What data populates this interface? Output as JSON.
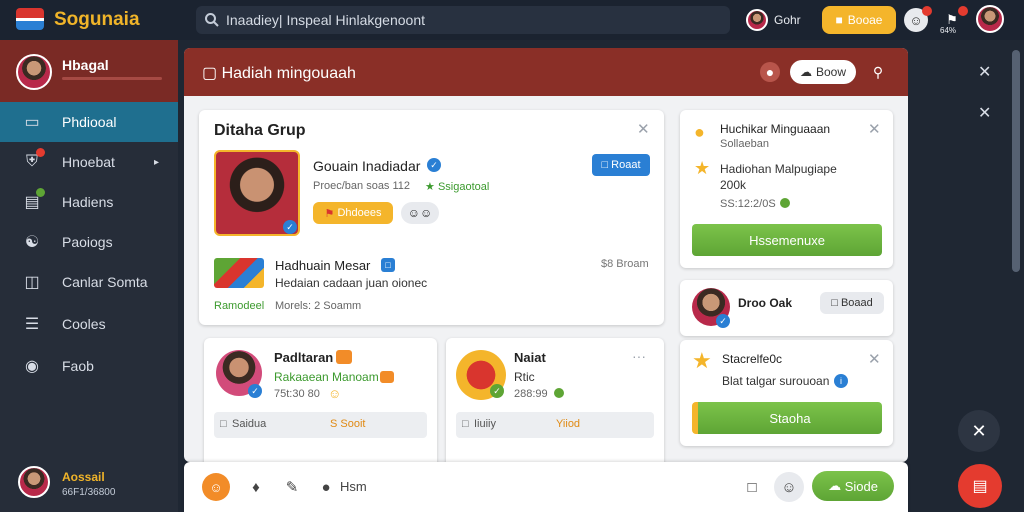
{
  "app": {
    "brand": "Sogunaia"
  },
  "search": {
    "placeholder": "Inaadiey| Inspeal Hinlakgenoont"
  },
  "topbar": {
    "user_name": "Gohr",
    "action_label": "Booae",
    "notif_count": "64%"
  },
  "sidebar": {
    "profile_name": "Hbagal",
    "items": [
      {
        "label": "Phdiooal",
        "icon": "monitor-icon"
      },
      {
        "label": "Hnoebat",
        "icon": "shield-icon"
      },
      {
        "label": "Hadiens",
        "icon": "folder-icon"
      },
      {
        "label": "Paoiogs",
        "icon": "person-icon"
      },
      {
        "label": "Canlar Somta",
        "icon": "briefcase-icon"
      },
      {
        "label": "Cooles",
        "icon": "book-icon"
      },
      {
        "label": "Faob",
        "icon": "globe-icon"
      }
    ],
    "footer_name": "Aossail",
    "footer_sub": "66F1/36800"
  },
  "panel": {
    "title": "Hadiah mingouaah",
    "pill_label": "Boow"
  },
  "group_card": {
    "title": "Ditaha Grup",
    "person_name": "Gouain Inadiadar",
    "person_meta": "Proec/ban soas 112",
    "person_status": "Ssigaotoal",
    "follow_label": "Roaat",
    "tag_label": "Dhdoees",
    "news_title": "Hadhuain Mesar",
    "news_time": "$8 Broam",
    "news_body": "Hedaian cadaan juan oionec",
    "foot_left": "Ramodeel",
    "foot_right": "Morels: 2 Soamm"
  },
  "mini_card_1": {
    "title": "Padltaran",
    "sub": "Rakaaean Manoam",
    "meta": "75t:30 80",
    "input_placeholder": "Saidua",
    "action": "S Sooit"
  },
  "mini_card_2": {
    "title": "Naiat",
    "sub": "Rtic",
    "meta": "288:99",
    "input_placeholder": "Iiuiiy",
    "action": "Yiiod"
  },
  "right_card_1": {
    "title": "Huchikar Minguaaan",
    "sub": "Sollaeban",
    "line1": "Hadiohan Malpugiape",
    "line2": "200k",
    "meta": "SS:12:2/0S",
    "button": "Hssemenuxe"
  },
  "right_card_2": {
    "name": "Droo Oak",
    "button": "Boaad"
  },
  "right_card_3": {
    "title": "Stacrelfe0c",
    "sub": "Blat talgar surouoan",
    "button": "Staoha"
  },
  "compose": {
    "placeholder": "Hsm",
    "send_label": "Siode"
  },
  "colors": {
    "accent_red": "#8a2f27",
    "accent_teal": "#1f6f8f",
    "accent_yellow": "#f4b52b",
    "accent_green": "#6ab43f"
  }
}
